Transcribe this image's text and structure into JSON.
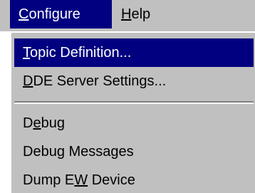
{
  "menubar": {
    "items": [
      {
        "mnemonic": "C",
        "rest": "onfigure",
        "active": true
      },
      {
        "mnemonic": "H",
        "rest": "elp",
        "active": false
      }
    ]
  },
  "dropdown": {
    "items": [
      {
        "before": "",
        "mnemonic": "T",
        "after": "opic Definition...",
        "highlighted": true
      },
      {
        "before": "",
        "mnemonic": "D",
        "after": "DE Server Settings...",
        "highlighted": false
      },
      {
        "before": "D",
        "mnemonic": "e",
        "after": "bug",
        "highlighted": false
      },
      {
        "before": "Debug Messages",
        "mnemonic": "",
        "after": "",
        "highlighted": false
      },
      {
        "before": "Dump E",
        "mnemonic": "W",
        "after": " Device",
        "highlighted": false
      }
    ]
  },
  "colors": {
    "menu_bg": "#c0c0c0",
    "highlight_bg": "#000080",
    "highlight_text": "#ffffff",
    "text": "#000000"
  }
}
